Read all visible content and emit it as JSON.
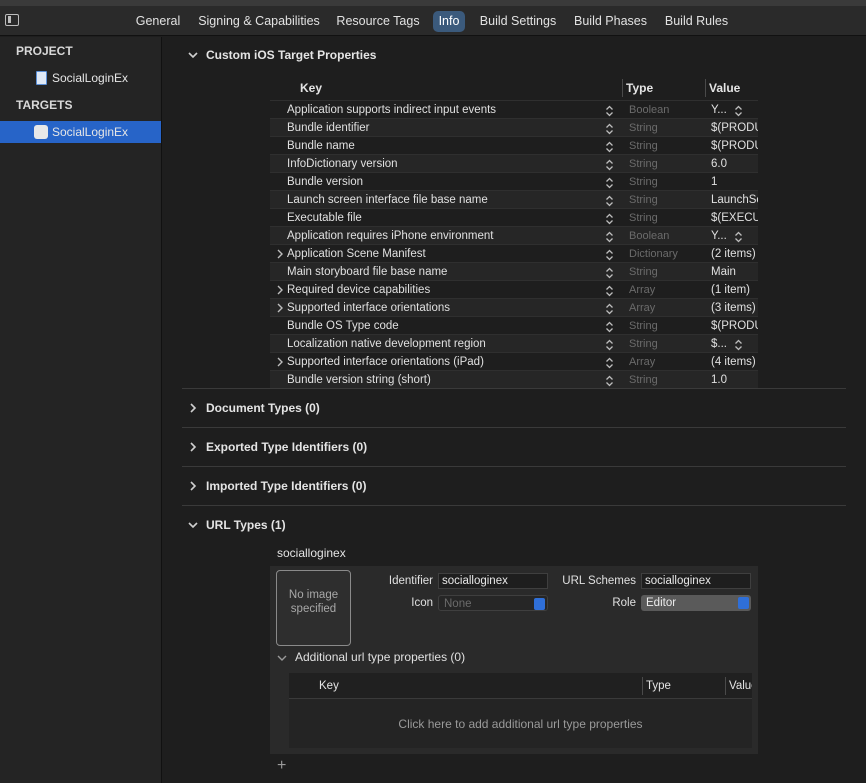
{
  "tabs": [
    {
      "label": "General",
      "active": false
    },
    {
      "label": "Signing & Capabilities",
      "active": false
    },
    {
      "label": "Resource Tags",
      "active": false
    },
    {
      "label": "Info",
      "active": true
    },
    {
      "label": "Build Settings",
      "active": false
    },
    {
      "label": "Build Phases",
      "active": false
    },
    {
      "label": "Build Rules",
      "active": false
    }
  ],
  "sidebar": {
    "project_header": "PROJECT",
    "project_item": "SocialLoginEx",
    "targets_header": "TARGETS",
    "target_item": "SocialLoginEx"
  },
  "custom_props": {
    "title": "Custom iOS Target Properties",
    "columns": {
      "key": "Key",
      "type": "Type",
      "value": "Value"
    },
    "rows": [
      {
        "key": "Application supports indirect input events",
        "type": "Boolean",
        "value": "Y...",
        "expandable": false,
        "value_stepper": true
      },
      {
        "key": "Bundle identifier",
        "type": "String",
        "value": "$(PRODUCT_BUNDLE_IDENTIFIER)",
        "expandable": false,
        "value_stepper": false
      },
      {
        "key": "Bundle name",
        "type": "String",
        "value": "$(PRODUCT_NAME)",
        "expandable": false,
        "value_stepper": false
      },
      {
        "key": "InfoDictionary version",
        "type": "String",
        "value": "6.0",
        "expandable": false,
        "value_stepper": false
      },
      {
        "key": "Bundle version",
        "type": "String",
        "value": "1",
        "expandable": false,
        "value_stepper": false
      },
      {
        "key": "Launch screen interface file base name",
        "type": "String",
        "value": "LaunchScreen",
        "expandable": false,
        "value_stepper": false
      },
      {
        "key": "Executable file",
        "type": "String",
        "value": "$(EXECUTABLE_NAME)",
        "expandable": false,
        "value_stepper": false
      },
      {
        "key": "Application requires iPhone environment",
        "type": "Boolean",
        "value": "Y...",
        "expandable": false,
        "value_stepper": true
      },
      {
        "key": "Application Scene Manifest",
        "type": "Dictionary",
        "value": "(2 items)",
        "expandable": true,
        "value_stepper": false
      },
      {
        "key": "Main storyboard file base name",
        "type": "String",
        "value": "Main",
        "expandable": false,
        "value_stepper": false
      },
      {
        "key": "Required device capabilities",
        "type": "Array",
        "value": "(1 item)",
        "expandable": true,
        "value_stepper": false
      },
      {
        "key": "Supported interface orientations",
        "type": "Array",
        "value": "(3 items)",
        "expandable": true,
        "value_stepper": false
      },
      {
        "key": "Bundle OS Type code",
        "type": "String",
        "value": "$(PRODUCT_BUNDLE_PACKAGE_TYPE)",
        "expandable": false,
        "value_stepper": false
      },
      {
        "key": "Localization native development region",
        "type": "String",
        "value": "$...",
        "expandable": false,
        "value_stepper": true
      },
      {
        "key": "Supported interface orientations (iPad)",
        "type": "Array",
        "value": "(4 items)",
        "expandable": true,
        "value_stepper": false
      },
      {
        "key": "Bundle version string (short)",
        "type": "String",
        "value": "1.0",
        "expandable": false,
        "value_stepper": false
      }
    ]
  },
  "sections": {
    "document_types": "Document Types (0)",
    "exported_types": "Exported Type Identifiers (0)",
    "imported_types": "Imported Type Identifiers (0)",
    "url_types": "URL Types (1)"
  },
  "url_type": {
    "name": "socialloginex",
    "image_placeholder": "No image specified",
    "identifier_label": "Identifier",
    "identifier_value": "socialloginex",
    "icon_label": "Icon",
    "icon_value": "None",
    "url_schemes_label": "URL Schemes",
    "url_schemes_value": "socialloginex",
    "role_label": "Role",
    "role_value": "Editor",
    "additional_title": "Additional url type properties (0)",
    "inner_columns": {
      "key": "Key",
      "type": "Type",
      "value": "Value"
    },
    "add_hint": "Click here to add additional url type properties",
    "add_symbol": "+"
  },
  "colors": {
    "accent": "#2764c8",
    "active_tab": "#3b5a7c",
    "background": "#1e1e1e"
  }
}
